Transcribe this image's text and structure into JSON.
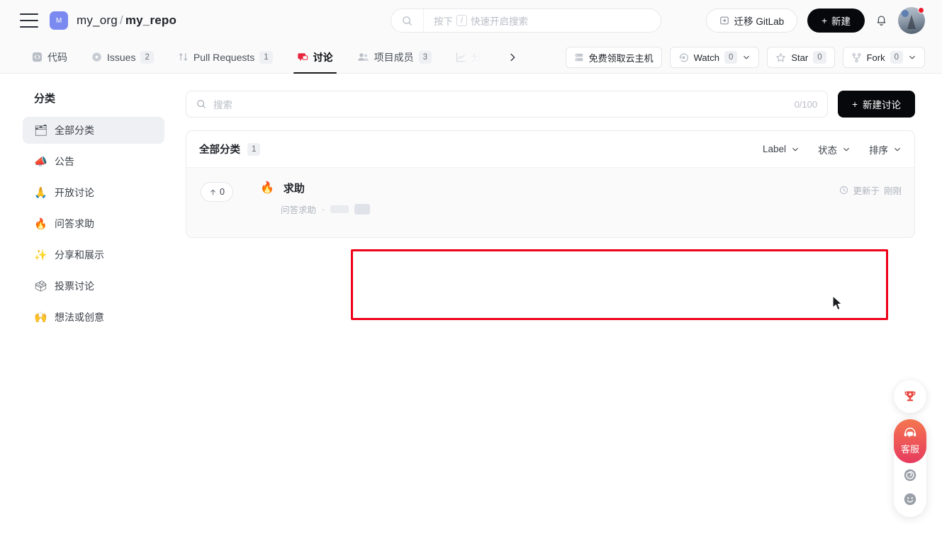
{
  "topbar": {
    "menu_icon": "hamburger-icon",
    "org_initial": "M",
    "org_name": "my_org",
    "separator": "/",
    "repo_name": "my_repo",
    "search_placeholder_prefix": "按下",
    "search_key": "/",
    "search_placeholder_suffix": "快速开启搜索",
    "migrate_gitlab_label": "迁移 GitLab",
    "new_button_label": "新建",
    "new_button_plus": "+",
    "notification_icon": "bell-icon",
    "avatar_icon": "user-avatar"
  },
  "tabs": [
    {
      "label": "代码",
      "count": "",
      "icon": "code-icon",
      "active": false,
      "faded": false
    },
    {
      "label": "Issues",
      "count": "2",
      "icon": "issue-icon",
      "active": false,
      "faded": false
    },
    {
      "label": "Pull Requests",
      "count": "1",
      "icon": "pull-request-icon",
      "active": false,
      "faded": false
    },
    {
      "label": "讨论",
      "count": "",
      "icon": "discussion-icon",
      "active": true,
      "faded": false
    },
    {
      "label": "项目成员",
      "count": "3",
      "icon": "members-icon",
      "active": false,
      "faded": false
    },
    {
      "label": "分析",
      "count": "",
      "icon": "analytics-icon",
      "active": false,
      "faded": true
    }
  ],
  "repo_actions": {
    "free_host_label": "免费领取云主机",
    "watch_label": "Watch",
    "watch_count": "0",
    "star_label": "Star",
    "star_count": "0",
    "fork_label": "Fork",
    "fork_count": "0"
  },
  "sidebar": {
    "title": "分类",
    "items": [
      {
        "emoji": "🗂",
        "label": "全部分类",
        "active": true
      },
      {
        "emoji": "📣",
        "label": "公告",
        "active": false
      },
      {
        "emoji": "🙏",
        "label": "开放讨论",
        "active": false
      },
      {
        "emoji": "🔥",
        "label": "问答求助",
        "active": false
      },
      {
        "emoji": "✨",
        "label": "分享和展示",
        "active": false
      },
      {
        "emoji": "🗳",
        "label": "投票讨论",
        "active": false
      },
      {
        "emoji": "🙌",
        "label": "想法或创意",
        "active": false
      }
    ]
  },
  "main": {
    "search_placeholder": "搜索",
    "search_value": "",
    "search_counter": "0/100",
    "new_discussion_label": "新建讨论",
    "new_discussion_plus": "+",
    "list_title": "全部分类",
    "list_count": "1",
    "filters": [
      {
        "label": "Label",
        "icon": "chevron-down-icon"
      },
      {
        "label": "状态",
        "icon": "chevron-down-icon"
      },
      {
        "label": "排序",
        "icon": "chevron-down-icon"
      }
    ],
    "discussions": [
      {
        "vote_count": "0",
        "vote_icon": "arrow-up-icon",
        "emoji": "🔥",
        "title": "求助",
        "category": "问答求助",
        "meta_separator": "·",
        "updated_icon": "clock-icon",
        "updated_label": "更新于",
        "updated_time": "刚刚"
      }
    ]
  },
  "float_widgets": {
    "trophy_icon": "trophy-icon",
    "support_label": "客服",
    "support_icon": "headset-icon",
    "refresh_icon": "spiral-icon",
    "feedback_icon": "smiley-icon",
    "support_gradient_top": "#f4774f",
    "support_gradient_bottom": "#e63b5e"
  },
  "highlight": {
    "color": "#ee0018"
  }
}
